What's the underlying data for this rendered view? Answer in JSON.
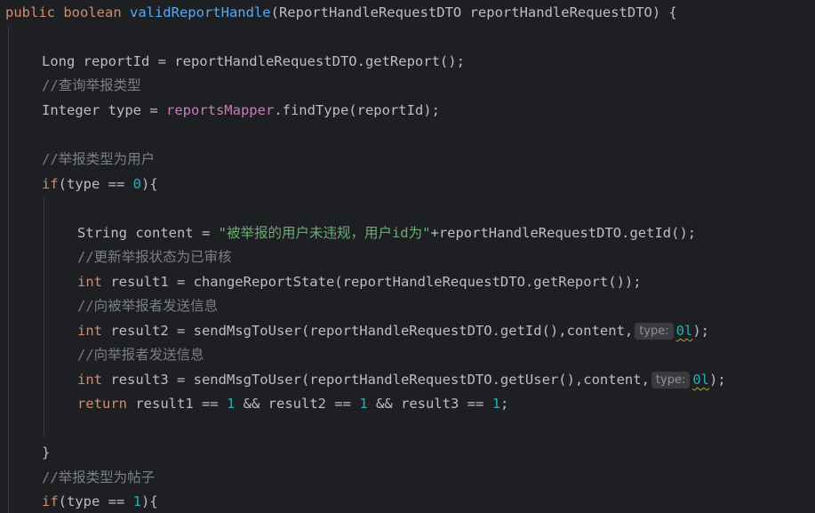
{
  "code": {
    "l1": {
      "kw": "public boolean ",
      "fn": "validReportHandle",
      "rest": "(ReportHandleRequestDTO reportHandleRequestDTO) {"
    },
    "l3": {
      "text": "Long reportId = reportHandleRequestDTO.getReport();"
    },
    "l4": {
      "comment": "//查询举报类型"
    },
    "l5": {
      "pre": "Integer type = ",
      "field": "reportsMapper",
      "post": ".findType(reportId);"
    },
    "l7": {
      "comment": "//举报类型为用户"
    },
    "l8": {
      "kw": "if",
      "pre": "(type == ",
      "num": "0",
      "post": "){"
    },
    "l10": {
      "pre": "String content = ",
      "str": "\"被举报的用户未违规，用户id为\"",
      "post": "+reportHandleRequestDTO.getId();"
    },
    "l11": {
      "comment": "//更新举报状态为已审核"
    },
    "l12": {
      "kw": "int ",
      "post": "result1 = changeReportState(reportHandleRequestDTO.getReport());"
    },
    "l13": {
      "comment": "//向被举报者发送信息"
    },
    "l14": {
      "kw": "int ",
      "pre": "result2 = sendMsgToUser(reportHandleRequestDTO.getId(),content,",
      "hint": "type:",
      "num": "0l",
      "post": ");"
    },
    "l15": {
      "comment": "//向举报者发送信息"
    },
    "l16": {
      "kw": "int ",
      "pre": "result3 = sendMsgToUser(reportHandleRequestDTO.getUser(),content,",
      "hint": "type:",
      "num": "0l",
      "post": ");"
    },
    "l17": {
      "kw": "return ",
      "a": "result1 == ",
      "n1": "1",
      "b": " && result2 == ",
      "n2": "1",
      "c": " && result3 == ",
      "n3": "1",
      "d": ";"
    },
    "l19": {
      "text": "}"
    },
    "l20": {
      "comment": "//举报类型为帖子"
    },
    "l21": {
      "kw": "if",
      "pre": "(type == ",
      "num": "1",
      "post": "){"
    }
  },
  "colors": {
    "background": "#1e1f22",
    "keyword": "#cf8e6d",
    "function": "#56a8f5",
    "field": "#c77dbb",
    "comment": "#7a7e85",
    "string": "#6aab73",
    "number": "#2aacb8",
    "text": "#bcbec4"
  }
}
